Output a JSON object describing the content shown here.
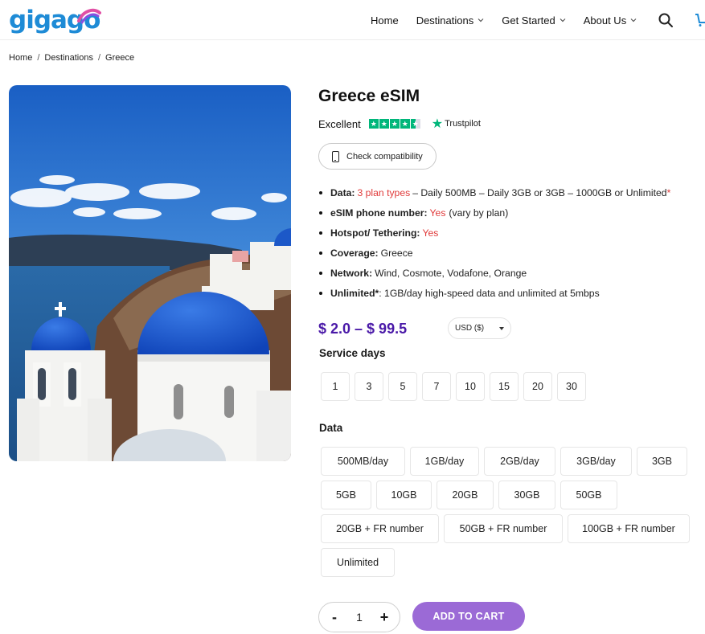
{
  "logo": {
    "text": "gigago"
  },
  "nav": {
    "items": [
      {
        "label": "Home"
      },
      {
        "label": "Destinations"
      },
      {
        "label": "Get Started"
      },
      {
        "label": "About Us"
      }
    ]
  },
  "breadcrumb": {
    "home": "Home",
    "destinations": "Destinations",
    "current": "Greece",
    "separator": "/"
  },
  "product": {
    "title": "Greece eSIM",
    "rating_label": "Excellent",
    "trustpilot": "Trustpilot",
    "compat_label": "Check compatibility",
    "features": {
      "data_label": "Data:",
      "data_link": "3 plan types",
      "data_text": "– Daily 500MB – Daily 3GB or 3GB – 1000GB or Unlimited",
      "data_asterisk": "*",
      "phone_label": "eSIM phone number:",
      "phone_value": "Yes",
      "phone_note": "(vary by plan)",
      "hotspot_label": "Hotspot/ Tethering:",
      "hotspot_value": "Yes",
      "coverage_label": "Coverage:",
      "coverage_value": "Greece",
      "network_label": "Network:",
      "network_value": "Wind, Cosmote, Vodafone, Orange",
      "unlimited_label": "Unlimited*",
      "unlimited_value": ": 1GB/day high-speed data and unlimited at 5mbps"
    },
    "price": "$ 2.0 – $ 99.5",
    "currency": "USD ($)",
    "service_days_label": "Service days",
    "service_days": [
      "1",
      "3",
      "5",
      "7",
      "10",
      "15",
      "20",
      "30"
    ],
    "data_label": "Data",
    "data_options": [
      "500MB/day",
      "1GB/day",
      "2GB/day",
      "3GB/day",
      "3GB",
      "5GB",
      "10GB",
      "20GB",
      "30GB",
      "50GB",
      "20GB + FR number",
      "50GB + FR number",
      "100GB + FR number",
      "Unlimited"
    ],
    "quantity": {
      "minus": "-",
      "value": "1",
      "plus": "+"
    },
    "add_to_cart": "ADD TO CART"
  },
  "colors": {
    "brand": "#1e8bd6",
    "price": "#4a19a8",
    "accent_red": "#e03a3a",
    "cta": "#9b6ad6",
    "trustpilot": "#00b67a"
  }
}
